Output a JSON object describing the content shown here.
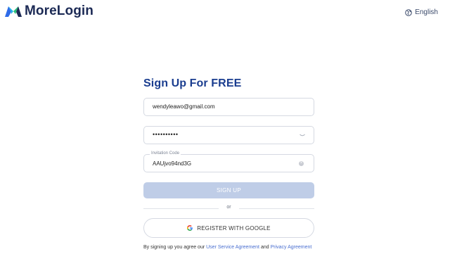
{
  "header": {
    "brand_name": "MoreLogin",
    "language_label": "English",
    "brand_color": "#1c2a55",
    "logo_colors": [
      "#2f6be8",
      "#21b6e6",
      "#28c17a",
      "#1c2a55"
    ]
  },
  "form": {
    "title": "Sign Up For FREE",
    "email_value": "wendyleawo@gmail.com",
    "password_mask": "••••••••••",
    "invitation_label": "Invitation Code",
    "invitation_value": "AAUjvo94nd3G",
    "signup_label": "SIGN UP",
    "or_label": "or",
    "google_label": "REGISTER WITH GOOGLE",
    "accent_color": "#1a3d8f",
    "signup_bg": "#bfcde7"
  },
  "terms": {
    "prefix": "By signing up you agree our ",
    "link1": "User Service Agreement",
    "middle": " and ",
    "link2": "Privacy Agreement",
    "link_color": "#4a6fd0"
  },
  "icons": [
    "morelogin-logo-icon",
    "globe-icon",
    "eye-closed-icon",
    "clear-icon",
    "google-icon"
  ]
}
